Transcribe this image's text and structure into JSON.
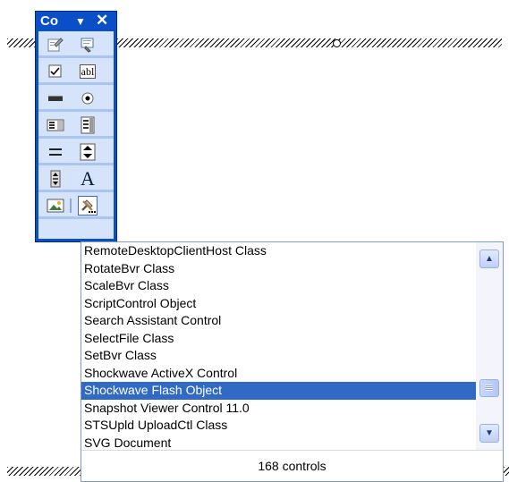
{
  "toolbox": {
    "title": "Co",
    "dropdown_glyph": "▼",
    "close_glyph": "✕",
    "rows": [
      [
        {
          "icon": "page-properties-icon"
        },
        {
          "icon": "view-code-icon"
        }
      ],
      [
        {
          "icon": "checkbox-control-icon"
        },
        {
          "icon": "textbox-control-icon",
          "label": "abl"
        }
      ],
      [
        {
          "icon": "command-button-icon"
        },
        {
          "icon": "option-button-icon"
        }
      ],
      [
        {
          "icon": "listbox-control-icon"
        },
        {
          "icon": "combobox-control-icon"
        }
      ],
      [
        {
          "icon": "scrollbar-control-icon"
        },
        {
          "icon": "spinner-control-icon"
        }
      ],
      [
        {
          "icon": "spin-button-icon"
        },
        {
          "icon": "label-control-icon",
          "label": "A"
        }
      ],
      [
        {
          "icon": "image-control-icon"
        },
        {
          "icon": "more-controls-icon"
        }
      ]
    ]
  },
  "dropdown": {
    "items": [
      "RemoteDesktopClientHost Class",
      "RotateBvr Class",
      "ScaleBvr Class",
      "ScriptControl Object",
      "Search Assistant Control",
      "SelectFile Class",
      "SetBvr Class",
      "Shockwave ActiveX Control",
      "Shockwave Flash Object",
      "Snapshot Viewer Control 11.0",
      "STSUpld UploadCtl Class",
      "SVG Document"
    ],
    "selected_index": 8,
    "footer": "168 controls",
    "scroll_up_glyph": "▲",
    "scroll_down_glyph": "▼"
  },
  "colors": {
    "toolbar_blue": "#0a4fc8",
    "selection": "#316ac5"
  }
}
